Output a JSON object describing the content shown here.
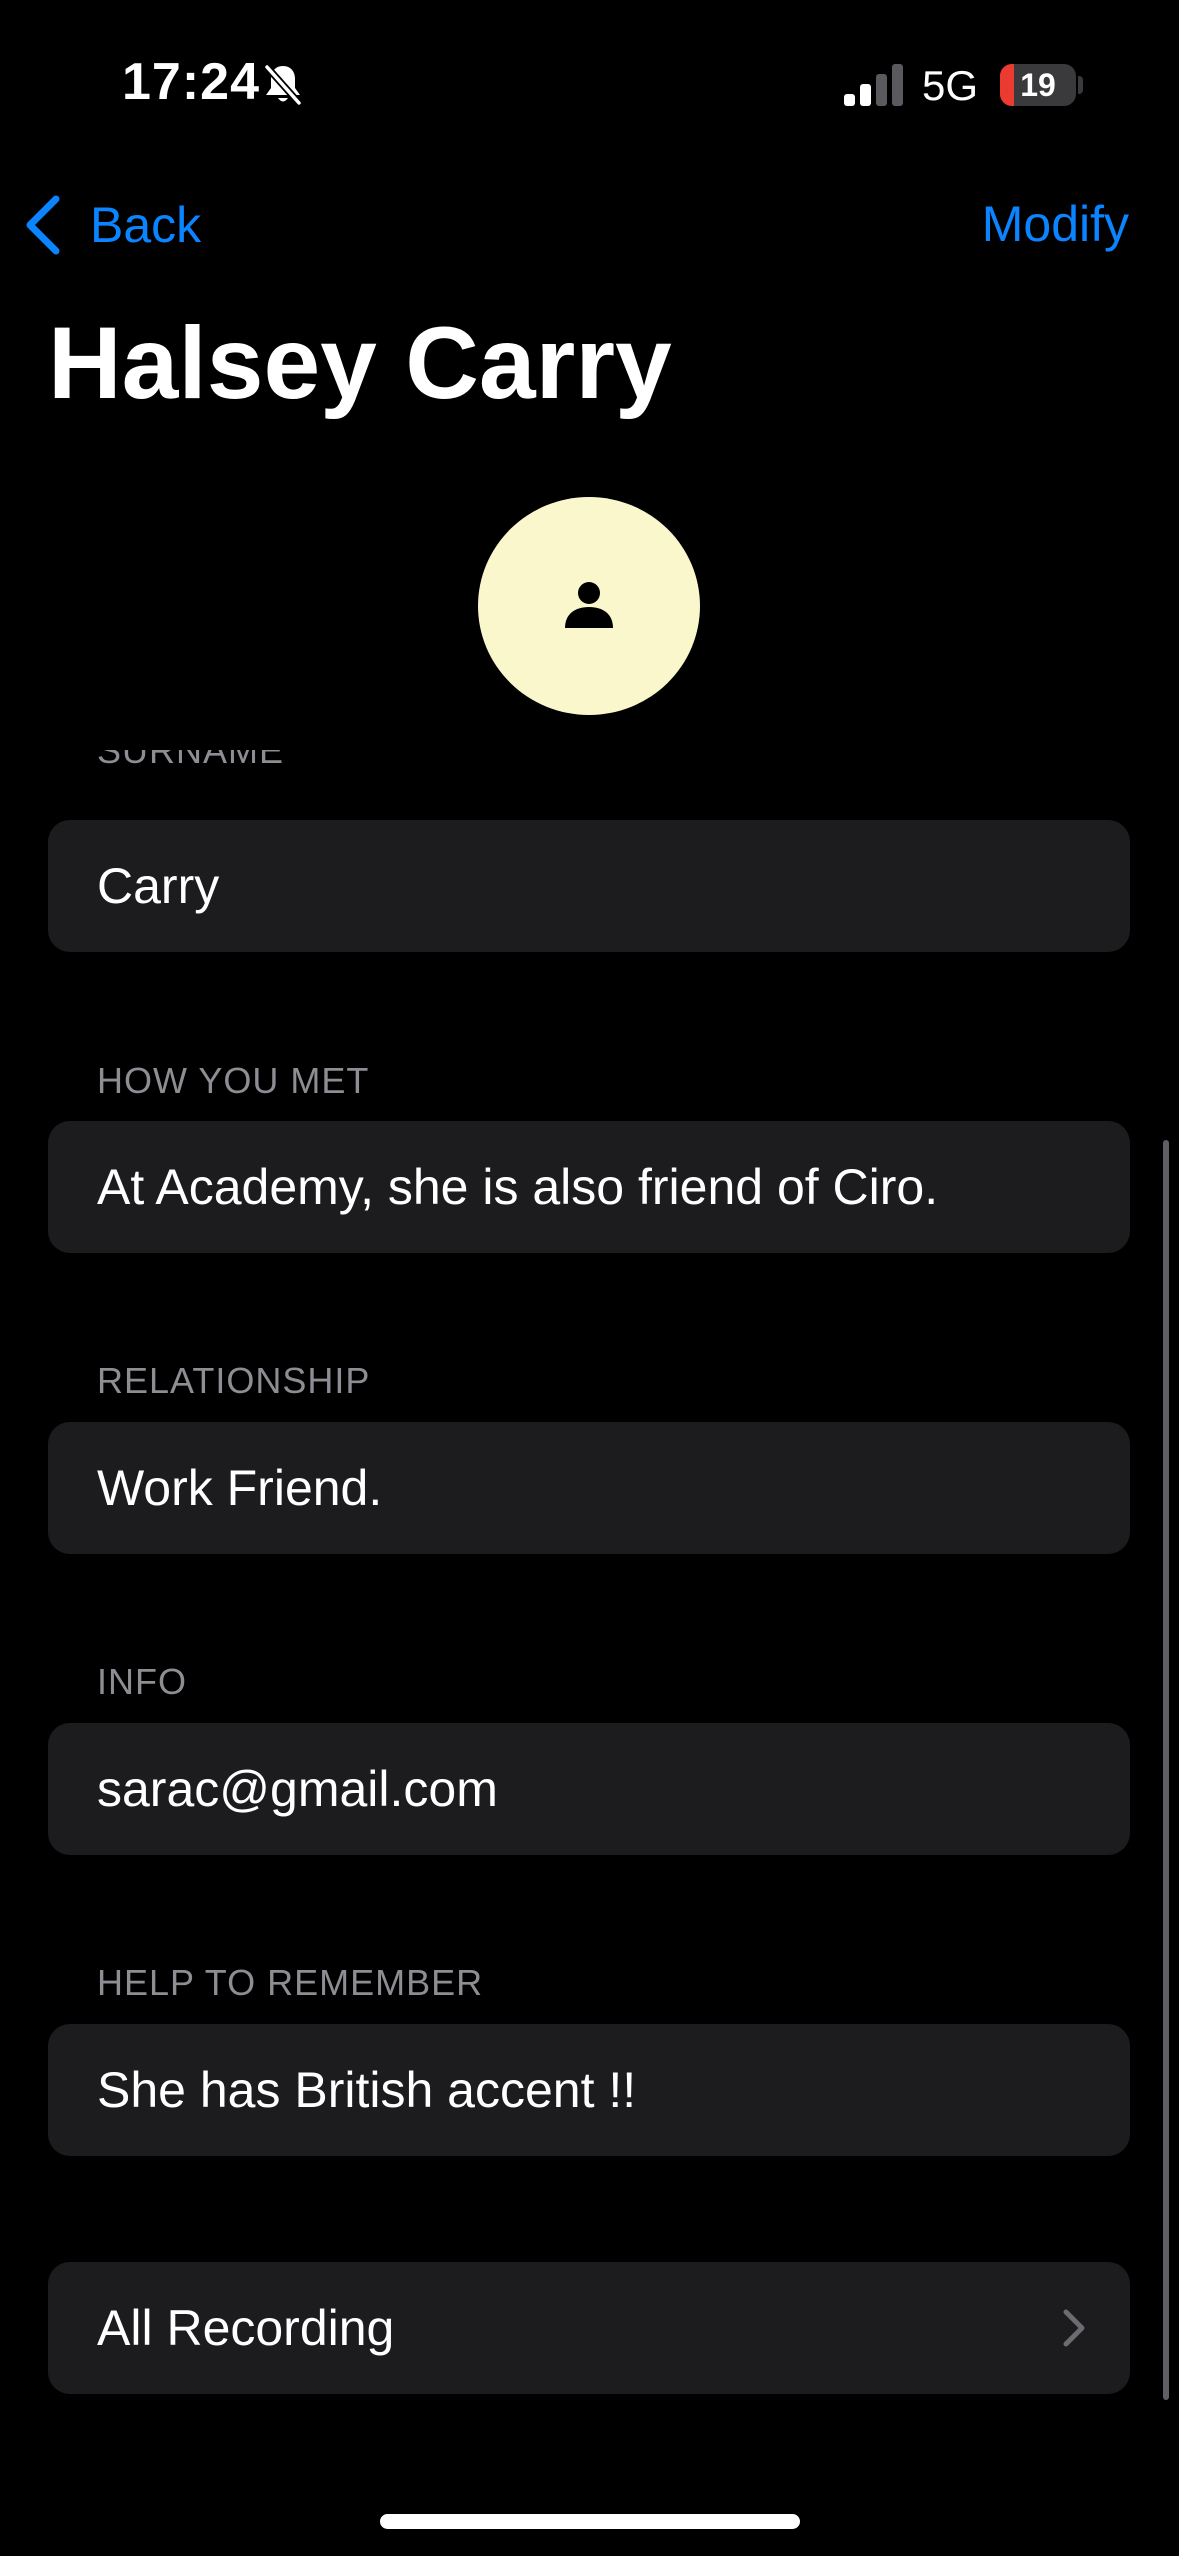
{
  "status_bar": {
    "time": "17:24",
    "network": "5G",
    "battery_percent": 19,
    "battery_text": "19",
    "icons": [
      "bell-slash-icon",
      "signal-icon"
    ]
  },
  "nav": {
    "back_label": "Back",
    "back_icon": "chevron-left-icon",
    "action_label": "Modify",
    "accent_color": "#0a84ff"
  },
  "contact": {
    "name": "Halsey Carry",
    "avatar_icon": "person-icon",
    "avatar_color": "#fbf7cc"
  },
  "fields": [
    {
      "label": "SURNAME",
      "value": "Carry"
    },
    {
      "label": "HOW YOU MET",
      "value": "At Academy, she is also friend of Ciro."
    },
    {
      "label": "RELATIONSHIP",
      "value": "Work Friend."
    },
    {
      "label": "INFO",
      "value": "sarac@gmail.com"
    },
    {
      "label": "HELP TO REMEMBER",
      "value": "She has British accent !!"
    }
  ],
  "recordings": {
    "label": "All Recording",
    "icon": "chevron-right-icon"
  }
}
